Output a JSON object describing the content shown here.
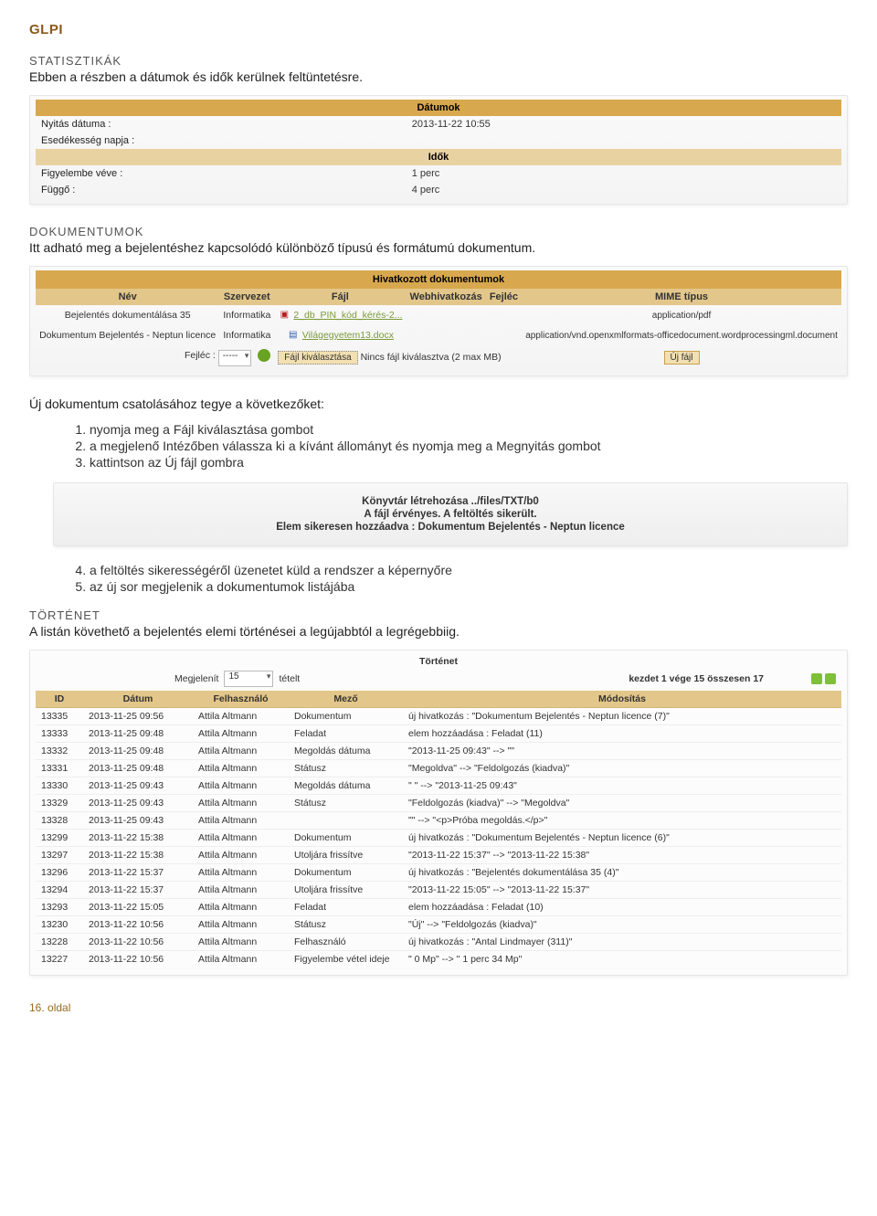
{
  "header": {
    "glpi": "GLPI"
  },
  "stats": {
    "title": "STATISZTIKÁK",
    "desc": "Ebben a részben a dátumok és idők kerülnek feltüntetésre.",
    "dates_header": "Dátumok",
    "open_label": "Nyitás dátuma :",
    "open_value": "2013-11-22 10:55",
    "due_label": "Esedékesség napja :",
    "due_value": "",
    "times_header": "Idők",
    "considered_label": "Figyelembe véve :",
    "considered_value": "1 perc",
    "pending_label": "Függő :",
    "pending_value": "4 perc"
  },
  "docs": {
    "title": "DOKUMENTUMOK",
    "desc": "Itt adható meg a bejelentéshez kapcsolódó különböző típusú és formátumú dokumentum.",
    "panel_title": "Hivatkozott dokumentumok",
    "cols": {
      "name": "Név",
      "org": "Szervezet",
      "file": "Fájl",
      "web": "Webhivatkozás",
      "head": "Fejléc",
      "mime": "MIME típus"
    },
    "rows": [
      {
        "name": "Bejelentés dokumentálása 35",
        "org": "Informatika",
        "icon": "pdf",
        "file": "2_db_PIN_kód_kérés-2...",
        "mime": "application/pdf"
      },
      {
        "name": "Dokumentum Bejelentés - Neptun licence",
        "org": "Informatika",
        "icon": "doc",
        "file": "Világegyetem13.docx",
        "mime": "application/vnd.openxmlformats-officedocument.wordprocessingml.document"
      }
    ],
    "footer": {
      "head_label": "Fejléc :",
      "head_value": "-----",
      "choose_file": "Fájl kiválasztása",
      "no_file": "Nincs fájl kiválasztva",
      "max": "(2 max MB)",
      "new_file": "Új fájl"
    }
  },
  "attach_steps": {
    "intro": "Új dokumentum csatolásához tegye a következőket:",
    "steps_a": [
      {
        "pre": "nyomja meg a ",
        "b": "Fájl kiválasztása",
        "post": " gombot"
      },
      {
        "pre": "a megjelenő Intézőben válassza ki a kívánt állományt és nyomja meg a ",
        "b": "Megnyitás",
        "post": " gombot"
      },
      {
        "pre": "kattintson az ",
        "b": "Új fájl",
        "post": " gombra"
      }
    ],
    "notice": {
      "l1": "Könyvtár létrehozása ../files/TXT/b0",
      "l2": "A fájl érvényes. A feltöltés sikerült.",
      "l3": "Elem sikeresen hozzáadva : Dokumentum Bejelentés - Neptun licence"
    },
    "steps_b": [
      "a feltöltés sikerességéről üzenetet küld a rendszer a képernyőre",
      "az új sor megjelenik a dokumentumok listájába"
    ]
  },
  "history": {
    "title": "TÖRTÉNET",
    "desc": "A listán követhető a bejelentés elemi történései a legújabbtól a legrégebbiig.",
    "panel_title": "Történet",
    "show_label": "Megjelenít",
    "show_value": "15",
    "show_suffix": "tételt",
    "range": "kezdet 1 vége 15 összesen 17",
    "cols": {
      "id": "ID",
      "date": "Dátum",
      "user": "Felhasználó",
      "field": "Mező",
      "mod": "Módosítás"
    },
    "rows": [
      {
        "id": "13335",
        "date": "2013-11-25 09:56",
        "user": "Attila Altmann",
        "field": "Dokumentum",
        "mod": "új hivatkozás : \"Dokumentum Bejelentés - Neptun licence (7)\""
      },
      {
        "id": "13333",
        "date": "2013-11-25 09:48",
        "user": "Attila Altmann",
        "field": "Feladat",
        "mod": "elem hozzáadása : Feladat (11)"
      },
      {
        "id": "13332",
        "date": "2013-11-25 09:48",
        "user": "Attila Altmann",
        "field": "Megoldás dátuma",
        "mod": "\"2013-11-25 09:43\" --> \"\""
      },
      {
        "id": "13331",
        "date": "2013-11-25 09:48",
        "user": "Attila Altmann",
        "field": "Státusz",
        "mod": "\"Megoldva\" --> \"Feldolgozás (kiadva)\""
      },
      {
        "id": "13330",
        "date": "2013-11-25 09:43",
        "user": "Attila Altmann",
        "field": "Megoldás dátuma",
        "mod": "\" \" --> \"2013-11-25 09:43\""
      },
      {
        "id": "13329",
        "date": "2013-11-25 09:43",
        "user": "Attila Altmann",
        "field": "Státusz",
        "mod": "\"Feldolgozás (kiadva)\" --> \"Megoldva\""
      },
      {
        "id": "13328",
        "date": "2013-11-25 09:43",
        "user": "Attila Altmann",
        "field": "",
        "mod": "\"\" --> \"<p>Próba megoldás.</p>\""
      },
      {
        "id": "13299",
        "date": "2013-11-22 15:38",
        "user": "Attila Altmann",
        "field": "Dokumentum",
        "mod": "új hivatkozás : \"Dokumentum Bejelentés - Neptun licence (6)\""
      },
      {
        "id": "13297",
        "date": "2013-11-22 15:38",
        "user": "Attila Altmann",
        "field": "Utoljára frissítve",
        "mod": "\"2013-11-22 15:37\" --> \"2013-11-22 15:38\""
      },
      {
        "id": "13296",
        "date": "2013-11-22 15:37",
        "user": "Attila Altmann",
        "field": "Dokumentum",
        "mod": "új hivatkozás : \"Bejelentés dokumentálása 35 (4)\""
      },
      {
        "id": "13294",
        "date": "2013-11-22 15:37",
        "user": "Attila Altmann",
        "field": "Utoljára frissítve",
        "mod": "\"2013-11-22 15:05\" --> \"2013-11-22 15:37\""
      },
      {
        "id": "13293",
        "date": "2013-11-22 15:05",
        "user": "Attila Altmann",
        "field": "Feladat",
        "mod": "elem hozzáadása : Feladat (10)"
      },
      {
        "id": "13230",
        "date": "2013-11-22 10:56",
        "user": "Attila Altmann",
        "field": "Státusz",
        "mod": "\"Új\" --> \"Feldolgozás (kiadva)\""
      },
      {
        "id": "13228",
        "date": "2013-11-22 10:56",
        "user": "Attila Altmann",
        "field": "Felhasználó",
        "mod": "új hivatkozás : \"Antal Lindmayer (311)\""
      },
      {
        "id": "13227",
        "date": "2013-11-22 10:56",
        "user": "Attila Altmann",
        "field": "Figyelembe vétel ideje",
        "mod": "\" 0 Mp\" --> \" 1 perc 34 Mp\""
      }
    ]
  },
  "footer": {
    "page": "16. oldal"
  }
}
